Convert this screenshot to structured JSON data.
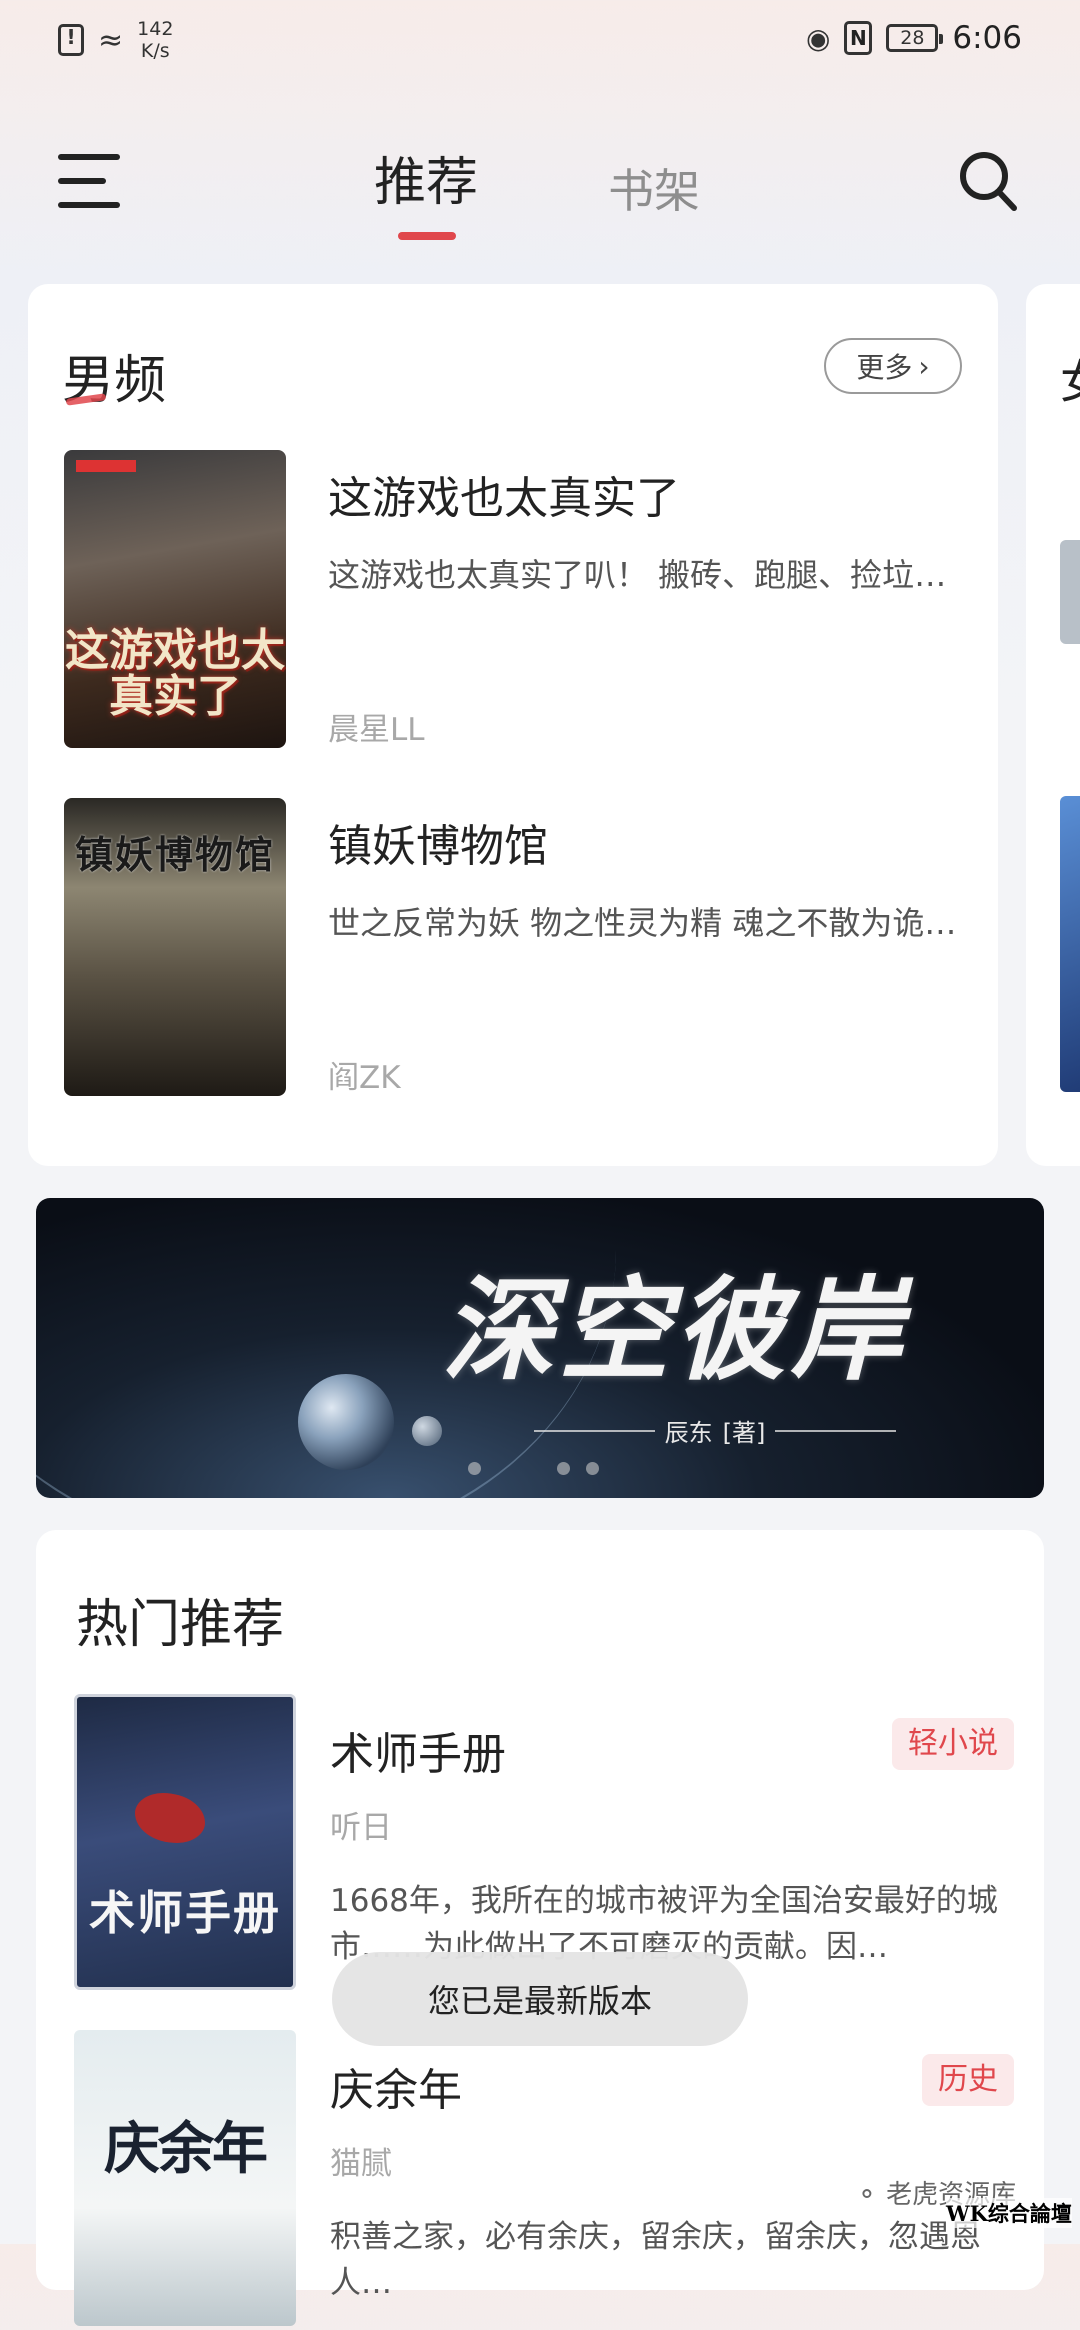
{
  "status_bar": {
    "speed_value": "142",
    "speed_unit": "K/s",
    "battery": "28",
    "time": "6:06"
  },
  "top_nav": {
    "tab_recommend": "推荐",
    "tab_bookshelf": "书架",
    "active_tab": "推荐"
  },
  "male_section": {
    "title": "男频",
    "more_label": "更多",
    "books": [
      {
        "title": "这游戏也太真实了",
        "description": "这游戏也太真实了叭！ 搬砖、跑腿、捡垃圾…",
        "author": "晨星LL",
        "cover_text": "这游戏也太真实了"
      },
      {
        "title": "镇妖博物馆",
        "description": "世之反常为妖 物之性灵为精 魂之不散为诡…",
        "author": "阎ZK",
        "cover_text": "镇妖博物馆"
      }
    ]
  },
  "right_peek": {
    "title": "女"
  },
  "banner": {
    "title": "深空彼岸",
    "author": "辰东",
    "author_suffix": "[著]",
    "slide_count": 4,
    "active_slide": 2
  },
  "hot_section": {
    "title": "热门推荐",
    "books": [
      {
        "title": "术师手册",
        "tag": "轻小说",
        "author": "听日",
        "description": "1668年，我所在的城市被评为全国治安最好的城市……为此做出了不可磨灭的贡献。因…",
        "cover_text": "术师手册"
      },
      {
        "title": "庆余年",
        "tag": "历史",
        "author": "猫腻",
        "description": "积善之家，必有余庆，留余庆，留余庆，忽遇恩人…",
        "cover_text": "庆余年"
      }
    ]
  },
  "toast": {
    "message": "您已是最新版本"
  },
  "watermark": {
    "line1": "老虎资源库",
    "line2": "WK综合論壇"
  },
  "colors": {
    "accent": "#e0474c",
    "tag_bg": "#fbe9ea",
    "card_bg": "#ffffff",
    "page_bg": "#f3f4f7"
  }
}
